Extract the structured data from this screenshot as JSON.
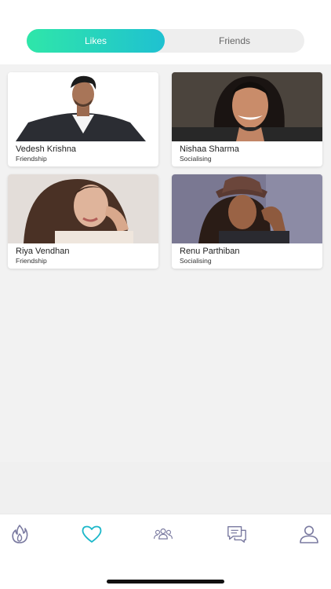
{
  "tabs_top": {
    "likes_label": "Likes",
    "friends_label": "Friends"
  },
  "cards": [
    {
      "name": "Vedesh Krishna",
      "tag": "Friendship"
    },
    {
      "name": "Nishaa Sharma",
      "tag": "Socialising"
    },
    {
      "name": "Riya Vendhan",
      "tag": "Friendship"
    },
    {
      "name": "Renu Parthiban",
      "tag": "Socialising"
    }
  ],
  "bottom_nav": {
    "items": [
      "fire-icon",
      "heart-icon",
      "group-icon",
      "chat-icon",
      "profile-icon"
    ],
    "active": "heart-icon"
  },
  "colors": {
    "accent_start": "#2fe6a9",
    "accent_end": "#1fc1d1",
    "active_icon": "#1bb7c9",
    "inactive_icon": "#7a7aa0"
  }
}
